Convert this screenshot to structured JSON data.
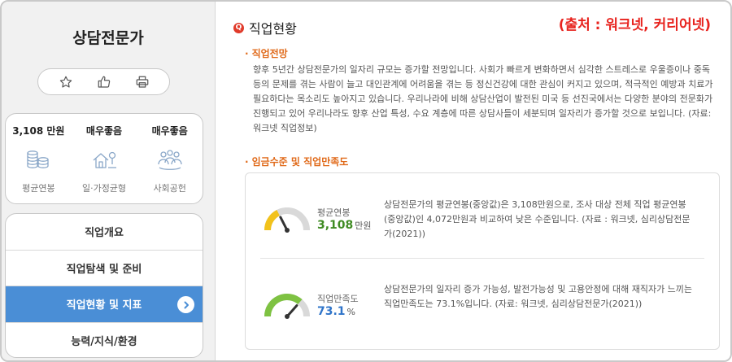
{
  "sidebar": {
    "title": "상담전문가",
    "stats": [
      {
        "value": "3,108 만원",
        "label": "평균연봉",
        "icon": "money-stack-icon"
      },
      {
        "value": "매우좋음",
        "label": "일·가정균형",
        "icon": "home-balance-icon"
      },
      {
        "value": "매우좋음",
        "label": "사회공헌",
        "icon": "people-group-icon"
      }
    ],
    "menu": [
      {
        "label": "직업개요",
        "active": false
      },
      {
        "label": "직업탐색 및 준비",
        "active": false
      },
      {
        "label": "직업현황 및 지표",
        "active": true
      },
      {
        "label": "능력/지식/환경",
        "active": false
      }
    ]
  },
  "main": {
    "section_title": "직업현황",
    "source": "(출처 : 워크넷, 커리어넷)",
    "outlook": {
      "heading": "직업전망",
      "text": "향후 5년간 상담전문가의 일자리 규모는 증가할 전망입니다. 사회가 빠르게 변화하면서 심각한 스트레스로 우울증이나 중독 등의 문제를 겪는 사람이 늘고 대인관계에 어려움을 겪는 등 정신건강에 대한 관심이 커지고 있으며, 적극적인 예방과 치료가 필요하다는 목소리도 높아지고 있습니다. 우리나라에 비해 상담산업이 발전된 미국 등 선진국에서는 다양한 분야의 전문화가 진행되고 있어 우리나라도 향후 산업 특성, 수요 계층에 따른 상담사들이 세분되며 일자리가 증가할 것으로 보입니다. (자료: 워크넷 직업정보)"
    },
    "wage": {
      "heading": "임금수준 및 직업만족도",
      "salary": {
        "label": "평균연봉",
        "value": "3,108",
        "unit": "만원",
        "level": 0.35,
        "color": "#f2c21b",
        "desc": "상담전문가의 평균연봉(중앙값)은 3,108만원으로, 조사 대상 전체 직업 평균연봉(중앙값)인 4,072만원과 비교하여 낮은 수준입니다. (자료 : 워크넷, 심리상담전문가(2021))"
      },
      "satisfaction": {
        "label": "직업만족도",
        "value": "73.1",
        "unit": "%",
        "level": 0.731,
        "color": "#7ec242",
        "desc": "상담전문가의 일자리 증가 가능성, 발전가능성 및 고용안정에 대해 재직자가 느끼는 직업만족도는 73.1%입니다. (자료: 워크넷, 심리상담전문가(2021))"
      }
    }
  },
  "colors": {
    "accent": "#4a8ed6",
    "source_red": "#e8231e",
    "subhead_orange": "#e06a1a",
    "salary_value": "#3f8b23",
    "satisfaction_value": "#2f74c9"
  }
}
